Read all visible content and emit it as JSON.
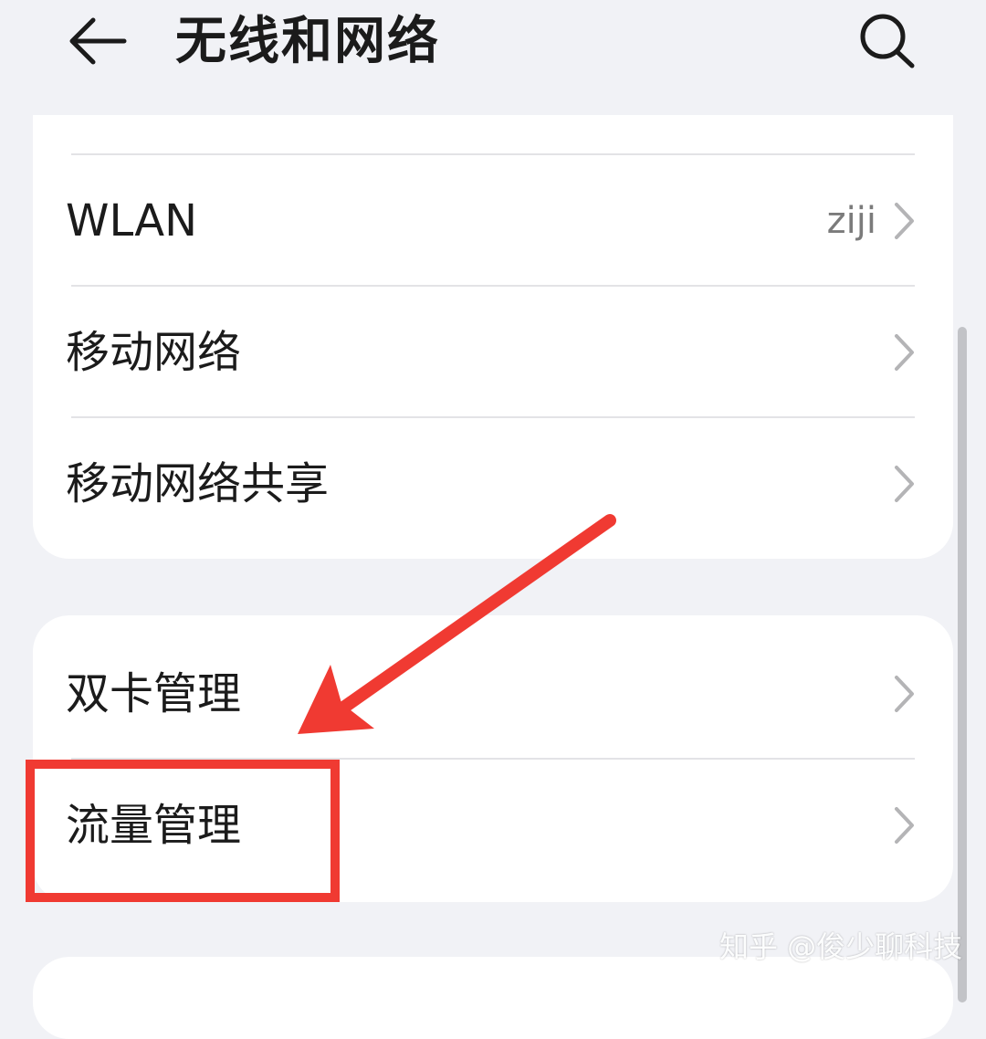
{
  "header": {
    "title": "无线和网络",
    "back_icon": "back-arrow-icon",
    "search_icon": "search-icon"
  },
  "sections": [
    {
      "items": [
        {
          "label": "WLAN",
          "value": "ziji"
        },
        {
          "label": "移动网络",
          "value": ""
        },
        {
          "label": "移动网络共享",
          "value": ""
        }
      ]
    },
    {
      "items": [
        {
          "label": "双卡管理",
          "value": ""
        },
        {
          "label": "流量管理",
          "value": ""
        }
      ]
    }
  ],
  "annotation": {
    "arrow_color": "#f03a32",
    "box_color": "#f03a32"
  },
  "watermark": "知乎 @俊少聊科技",
  "colors": {
    "background": "#f1f2f6",
    "card": "#ffffff",
    "text": "#1b1b1b",
    "secondary_text": "#7b7b7b",
    "chevron": "#b4b4b6",
    "highlight": "#f03a32"
  }
}
